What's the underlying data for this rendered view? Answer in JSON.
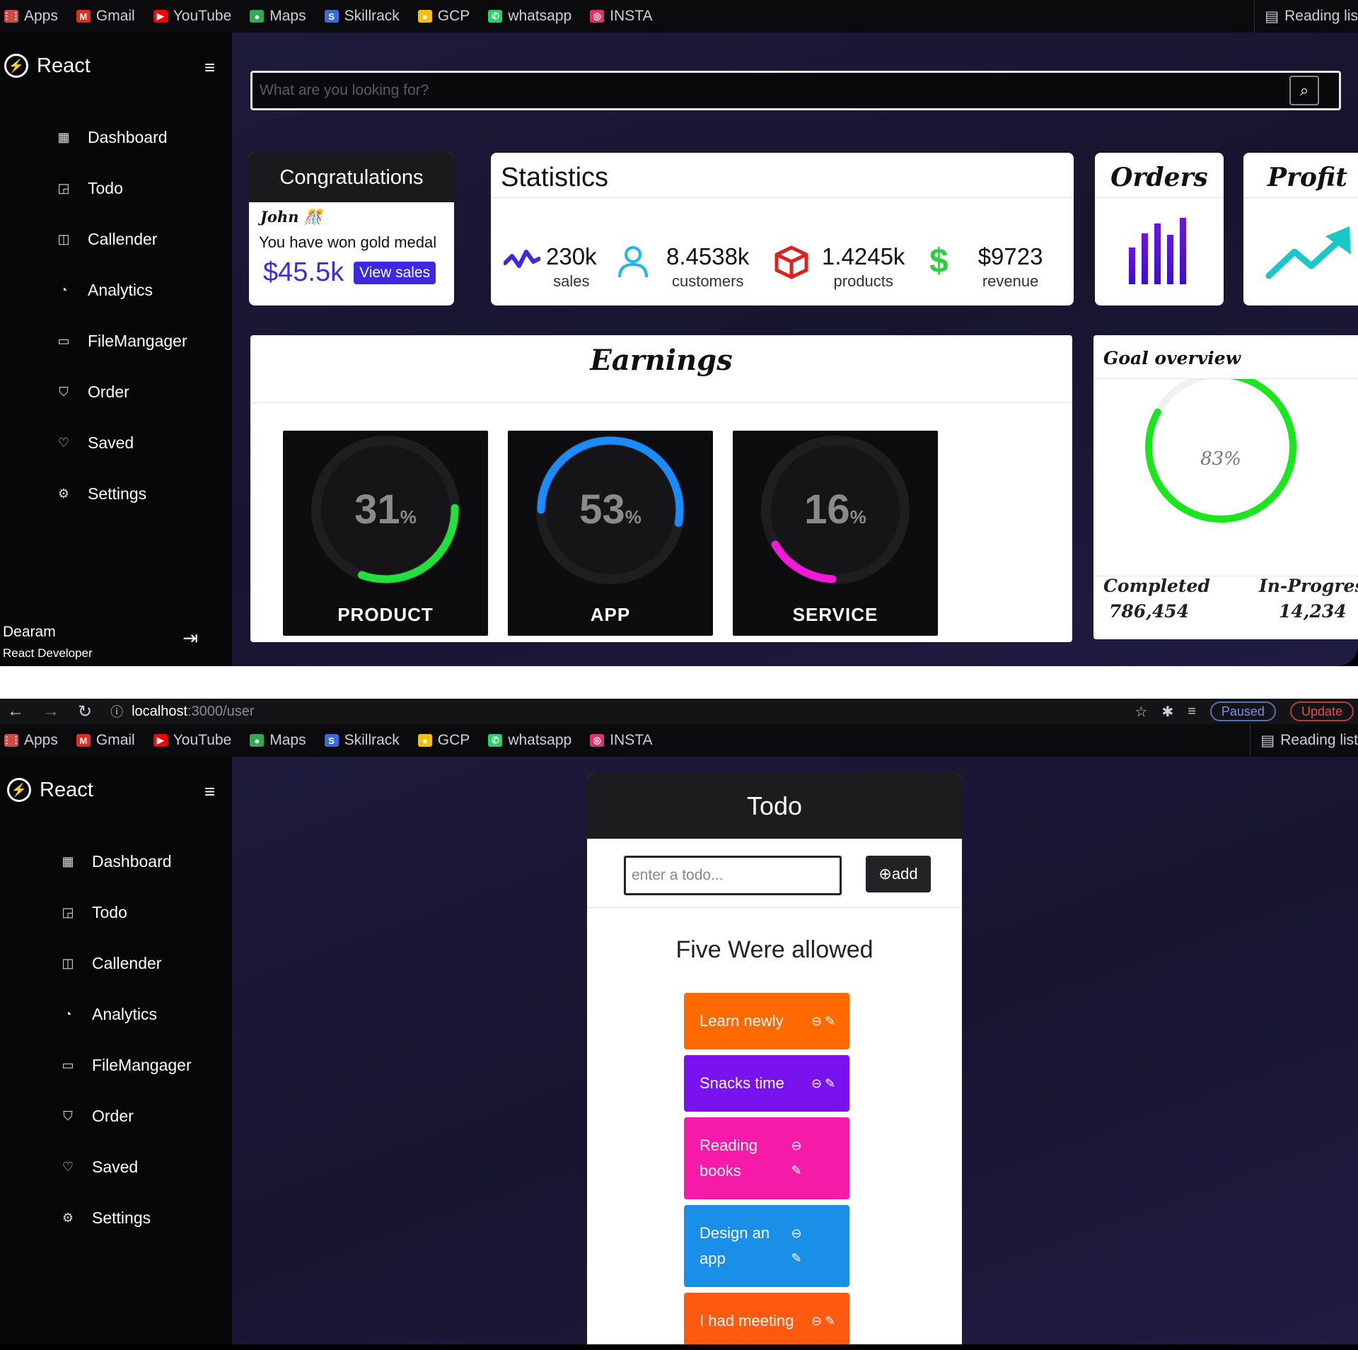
{
  "bookmarks": {
    "items": [
      {
        "label": "Apps",
        "icon": "apps-grid-icon",
        "color": "#d04a4a"
      },
      {
        "label": "Gmail",
        "icon": "gmail-icon",
        "color": "#d93025"
      },
      {
        "label": "YouTube",
        "icon": "youtube-icon",
        "color": "#ff0000"
      },
      {
        "label": "Maps",
        "icon": "maps-pin-icon",
        "color": "#34a853"
      },
      {
        "label": "Skillrack",
        "icon": "skillrack-icon",
        "color": "#3a6bd6"
      },
      {
        "label": "GCP",
        "icon": "gcp-icon",
        "color": "#f4c20d"
      },
      {
        "label": "whatsapp",
        "icon": "whatsapp-icon",
        "color": "#25d366"
      },
      {
        "label": "INSTA",
        "icon": "instagram-icon",
        "color": "#e1306c"
      }
    ],
    "reading_list_top": "Reading lis",
    "reading_list_bottom": "Reading list"
  },
  "toolbar": {
    "url_host": "localhost",
    "url_path": ":3000/user",
    "paused_label": "Paused",
    "update_label": "Update"
  },
  "sidebar": {
    "brand": "React",
    "items": [
      {
        "label": "Dashboard",
        "icon": "grid-icon"
      },
      {
        "label": "Todo",
        "icon": "note-icon"
      },
      {
        "label": "Callender",
        "icon": "calendar-icon"
      },
      {
        "label": "Analytics",
        "icon": "pie-chart-icon"
      },
      {
        "label": "FileMangager",
        "icon": "folder-icon"
      },
      {
        "label": "Order",
        "icon": "cart-icon"
      },
      {
        "label": "Saved",
        "icon": "heart-icon"
      },
      {
        "label": "Settings",
        "icon": "gear-icon"
      }
    ],
    "profile": {
      "name": "Dearam",
      "role": "React Developer"
    }
  },
  "dashboard": {
    "search_placeholder": "What are you looking for?",
    "congrats": {
      "title": "Congratulations",
      "name": "John",
      "message": "You have won gold medal",
      "amount": "$45.5k",
      "button": "View sales"
    },
    "statistics": {
      "title": "Statistics",
      "items": [
        {
          "value": "230k",
          "label": "sales",
          "icon": "activity-icon",
          "color": "#3d2ae0"
        },
        {
          "value": "8.4538k",
          "label": "customers",
          "icon": "user-icon",
          "color": "#1fb6e8"
        },
        {
          "value": "1.4245k",
          "label": "products",
          "icon": "box-icon",
          "color": "#e02020"
        },
        {
          "value": "$9723",
          "label": "revenue",
          "icon": "dollar-icon",
          "color": "#2ecc40"
        }
      ]
    },
    "orders_title": "Orders",
    "profit_title": "Profit",
    "earnings": {
      "title": "Earnings",
      "gauges": [
        {
          "label": "PRODUCT",
          "value": 31,
          "color": "#22e03c"
        },
        {
          "label": "APP",
          "value": 53,
          "color": "#1a8cff"
        },
        {
          "label": "SERVICE",
          "value": 16,
          "color": "#f01ad8"
        }
      ],
      "percent_sign": "%"
    },
    "goal": {
      "title": "Goal overview",
      "percent": 83,
      "percent_label": "83%",
      "color": "#19e61d",
      "completed_label": "Completed",
      "completed_value": "786,454",
      "progress_label": "In-Progress",
      "progress_value": "14,234"
    }
  },
  "todo": {
    "title": "Todo",
    "input_placeholder": "enter a todo...",
    "add_label": "add",
    "note": "Five Were allowed",
    "items": [
      {
        "text": "Learn newly",
        "color": "#ff6a00"
      },
      {
        "text": "Snacks time",
        "color": "#7a12f0"
      },
      {
        "text": "Reading books",
        "color": "#f51aa8"
      },
      {
        "text": "Design an app",
        "color": "#1a8fe8"
      },
      {
        "text": "I had meeting",
        "color": "#ff5a10"
      }
    ]
  }
}
